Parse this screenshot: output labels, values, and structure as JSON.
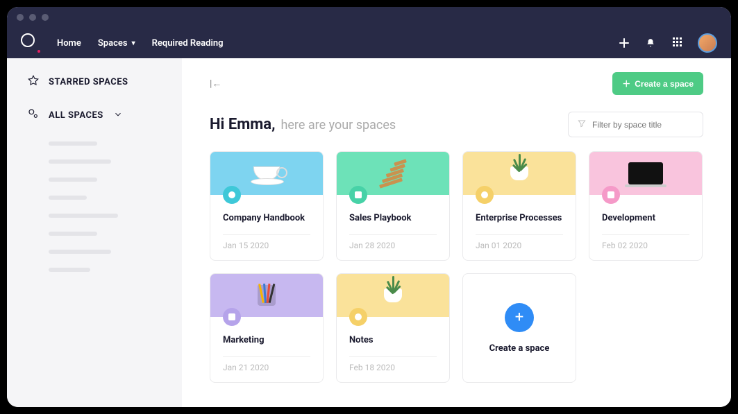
{
  "nav": {
    "home": "Home",
    "spaces": "Spaces",
    "required_reading": "Required Reading"
  },
  "sidebar": {
    "starred": "STARRED SPACES",
    "all": "ALL SPACES"
  },
  "toolbar": {
    "create_button": "Create a space"
  },
  "header": {
    "greeting": "Hi Emma,",
    "subtitle": "here are your spaces",
    "filter_placeholder": "Filter by space title"
  },
  "spaces": [
    {
      "title": "Company Handbook",
      "date": "Jan 15 2020",
      "bg": "#7ed4f0",
      "badge": "#3ec8d8",
      "badge_shape": "circle"
    },
    {
      "title": "Sales Playbook",
      "date": "Jan 28 2020",
      "bg": "#6de2b8",
      "badge": "#47d2a7",
      "badge_shape": "square"
    },
    {
      "title": "Enterprise Processes",
      "date": "Jan 01 2020",
      "bg": "#fae29a",
      "badge": "#f5d068",
      "badge_shape": "circle"
    },
    {
      "title": "Development",
      "date": "Feb 02 2020",
      "bg": "#f9c4dd",
      "badge": "#f59ac8",
      "badge_shape": "square"
    },
    {
      "title": "Marketing",
      "date": "Jan 21 2020",
      "bg": "#c7b8f0",
      "badge": "#b5a3ea",
      "badge_shape": "square"
    },
    {
      "title": "Notes",
      "date": "Feb 18 2020",
      "bg": "#fae29a",
      "badge": "#f5d068",
      "badge_shape": "circle"
    }
  ],
  "create_card": {
    "label": "Create a space"
  }
}
